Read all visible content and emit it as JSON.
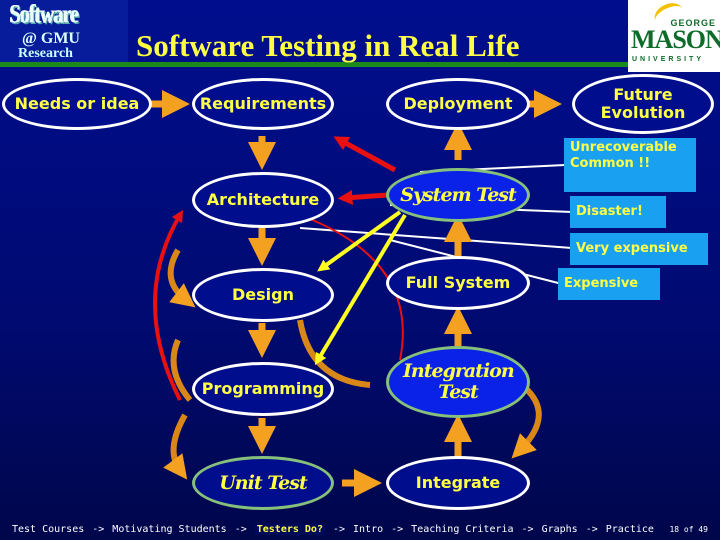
{
  "header": {
    "title": "Software Testing in Real Life",
    "left_logo": {
      "top": "Software",
      "middle": "@ GMU",
      "bottom": "Research"
    },
    "right_logo": {
      "line1": "GEORGE",
      "line2": "MASON",
      "line3": "UNIVERSITY"
    }
  },
  "nodes": {
    "needs": "Needs or idea",
    "requirements": "Requirements",
    "architecture": "Architecture",
    "design": "Design",
    "programming": "Programming",
    "unit_test": "Unit Test",
    "integrate": "Integrate",
    "integration_test": "Integration Test",
    "full_system": "Full System",
    "system_test": "System Test",
    "deployment": "Deployment",
    "future_evolution": "Future Evolution"
  },
  "callouts": {
    "unrecoverable": "Unrecoverable Common !!",
    "disaster": "Disaster!",
    "very_expensive": "Very expensive",
    "expensive": "Expensive"
  },
  "colors": {
    "background": "#000e8e",
    "node_text": "#ffff44",
    "flow_arrow": "#f4a020",
    "red_arrow": "#e81010",
    "yellow_arrow": "#ffff22",
    "callout_bg": "#1aa0f0",
    "test_border": "#86c07a"
  },
  "footer": {
    "items": [
      "Test Courses",
      "Motivating Students",
      "Testers Do?",
      "Intro",
      "Teaching Criteria",
      "Graphs",
      "Practice"
    ],
    "separator": "->",
    "active_index": 2,
    "page": "18 of 49"
  }
}
